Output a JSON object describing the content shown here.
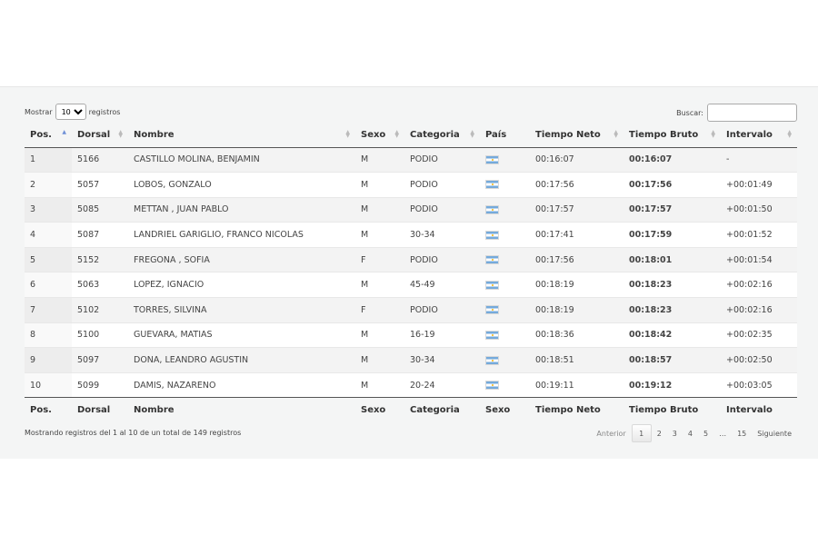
{
  "length_control": {
    "prefix": "Mostrar",
    "value": "10",
    "suffix": "registros"
  },
  "search": {
    "label": "Buscar:",
    "value": ""
  },
  "columns": [
    "Pos.",
    "Dorsal",
    "Nombre",
    "Sexo",
    "Categoria",
    "País",
    "Tiempo Neto",
    "Tiempo Bruto",
    "Intervalo"
  ],
  "footer_columns": [
    "Pos.",
    "Dorsal",
    "Nombre",
    "Sexo",
    "Categoria",
    "Sexo",
    "Tiempo Neto",
    "Tiempo Bruto",
    "Intervalo"
  ],
  "rows": [
    {
      "pos": "1",
      "dorsal": "5166",
      "nombre": "CASTILLO MOLINA, BENJAMIN",
      "sexo": "M",
      "categoria": "PODIO",
      "pais": "argentina-flag",
      "neto": "00:16:07",
      "bruto": "00:16:07",
      "intervalo": "-"
    },
    {
      "pos": "2",
      "dorsal": "5057",
      "nombre": "LOBOS, GONZALO",
      "sexo": "M",
      "categoria": "PODIO",
      "pais": "argentina-flag",
      "neto": "00:17:56",
      "bruto": "00:17:56",
      "intervalo": "+00:01:49"
    },
    {
      "pos": "3",
      "dorsal": "5085",
      "nombre": "METTAN , JUAN PABLO",
      "sexo": "M",
      "categoria": "PODIO",
      "pais": "argentina-flag",
      "neto": "00:17:57",
      "bruto": "00:17:57",
      "intervalo": "+00:01:50"
    },
    {
      "pos": "4",
      "dorsal": "5087",
      "nombre": "LANDRIEL GARIGLIO, FRANCO NICOLAS",
      "sexo": "M",
      "categoria": "30-34",
      "pais": "argentina-flag",
      "neto": "00:17:41",
      "bruto": "00:17:59",
      "intervalo": "+00:01:52"
    },
    {
      "pos": "5",
      "dorsal": "5152",
      "nombre": "FREGONA , SOFIA",
      "sexo": "F",
      "categoria": "PODIO",
      "pais": "argentina-flag",
      "neto": "00:17:56",
      "bruto": "00:18:01",
      "intervalo": "+00:01:54"
    },
    {
      "pos": "6",
      "dorsal": "5063",
      "nombre": "LOPEZ, IGNACIO",
      "sexo": "M",
      "categoria": "45-49",
      "pais": "argentina-flag",
      "neto": "00:18:19",
      "bruto": "00:18:23",
      "intervalo": "+00:02:16"
    },
    {
      "pos": "7",
      "dorsal": "5102",
      "nombre": "TORRES, SILVINA",
      "sexo": "F",
      "categoria": "PODIO",
      "pais": "argentina-flag",
      "neto": "00:18:19",
      "bruto": "00:18:23",
      "intervalo": "+00:02:16"
    },
    {
      "pos": "8",
      "dorsal": "5100",
      "nombre": "GUEVARA, MATIAS",
      "sexo": "M",
      "categoria": "16-19",
      "pais": "argentina-flag",
      "neto": "00:18:36",
      "bruto": "00:18:42",
      "intervalo": "+00:02:35"
    },
    {
      "pos": "9",
      "dorsal": "5097",
      "nombre": "DONA, LEANDRO AGUSTIN",
      "sexo": "M",
      "categoria": "30-34",
      "pais": "argentina-flag",
      "neto": "00:18:51",
      "bruto": "00:18:57",
      "intervalo": "+00:02:50"
    },
    {
      "pos": "10",
      "dorsal": "5099",
      "nombre": "DAMIS, NAZARENO",
      "sexo": "M",
      "categoria": "20-24",
      "pais": "argentina-flag",
      "neto": "00:19:11",
      "bruto": "00:19:12",
      "intervalo": "+00:03:05"
    }
  ],
  "info_text": "Mostrando registros del 1 al 10 de un total de 149 registros",
  "pagination": {
    "previous": "Anterior",
    "pages": [
      "1",
      "2",
      "3",
      "4",
      "5",
      "…",
      "15"
    ],
    "current": "1",
    "next": "Siguiente"
  }
}
